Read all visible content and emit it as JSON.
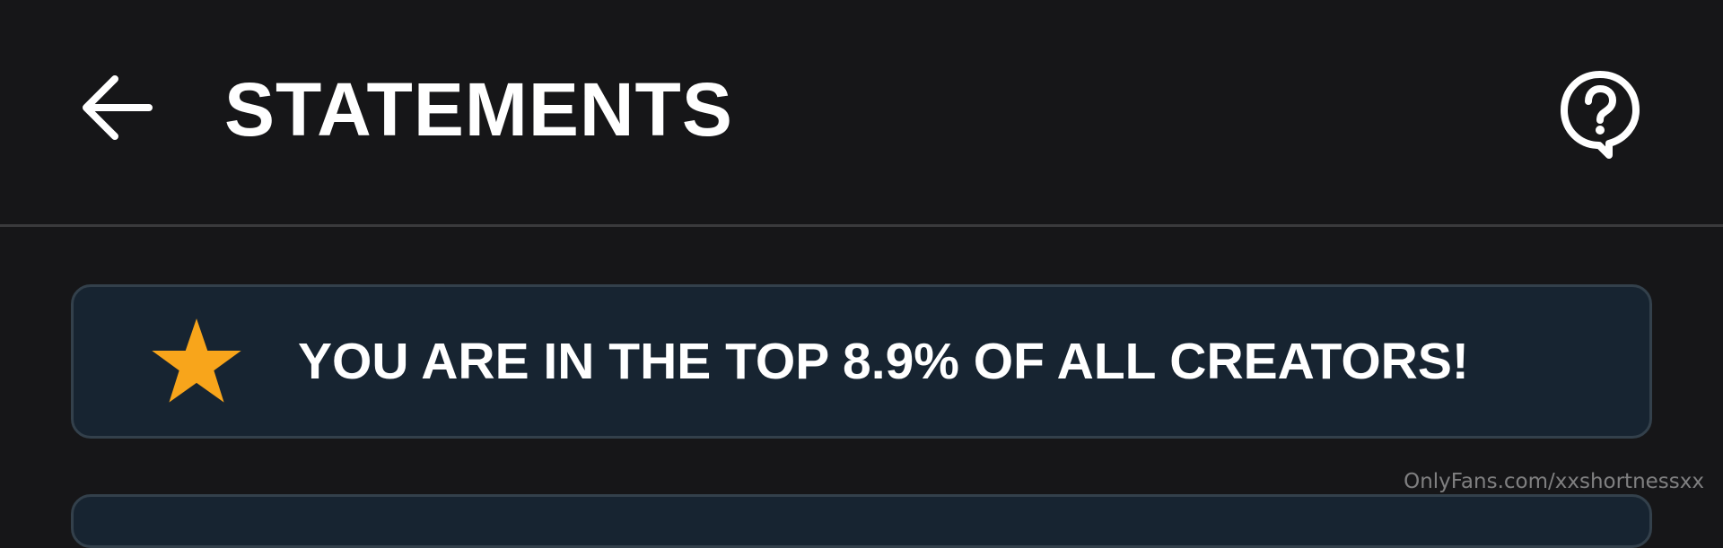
{
  "header": {
    "back_icon": "arrow-left-icon",
    "title": "STATEMENTS",
    "help_icon": "help-bubble-icon"
  },
  "banner": {
    "icon": "star-icon",
    "icon_color": "#f8a51b",
    "text": "YOU ARE IN THE TOP 8.9% OF ALL CREATORS!"
  },
  "watermark": {
    "text": "OnlyFans.com/xxshortnessxx"
  },
  "colors": {
    "background": "#161618",
    "banner_background": "#172431",
    "banner_border": "#33404b",
    "divider": "#3a3a3c"
  }
}
